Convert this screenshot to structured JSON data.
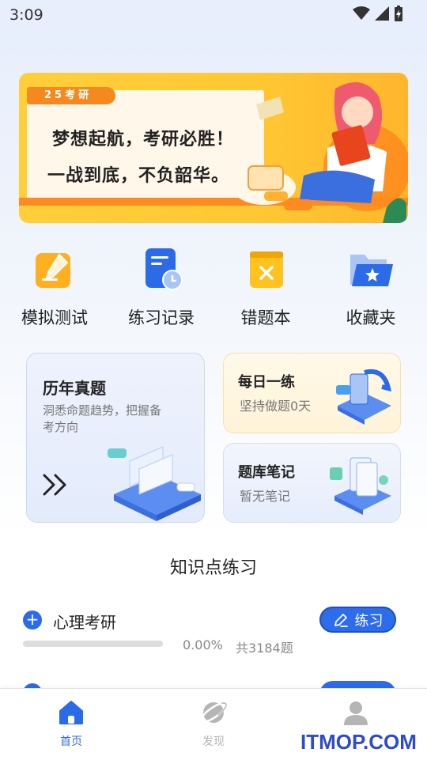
{
  "status_bar": {
    "time": "3:09"
  },
  "banner": {
    "tag": "25考研",
    "line1": "梦想起航，考研必胜！",
    "line2": "一战到底，不负韶华。"
  },
  "quick_actions": [
    {
      "label": "模拟测试",
      "icon": "pencil-note-icon"
    },
    {
      "label": "练习记录",
      "icon": "document-clock-icon"
    },
    {
      "label": "错题本",
      "icon": "wrong-book-icon"
    },
    {
      "label": "收藏夹",
      "icon": "star-folder-icon"
    }
  ],
  "cards": {
    "past_exams": {
      "title": "历年真题",
      "subtitle": "洞悉命题趋势，把握备考方向"
    },
    "daily": {
      "title": "每日一练",
      "subtitle": "坚持做题0天"
    },
    "notes": {
      "title": "题库笔记",
      "subtitle": "暂无笔记"
    }
  },
  "knowledge": {
    "section_title": "知识点练习",
    "items": [
      {
        "name": "心理考研",
        "progress_percent": 0,
        "percent_text": "0.00%",
        "total_text": "共3184题",
        "button": "练习"
      }
    ]
  },
  "bottom_nav": [
    {
      "label": "首页",
      "icon": "home-icon",
      "active": true
    },
    {
      "label": "发现",
      "icon": "planet-icon",
      "active": false
    },
    {
      "label": "",
      "icon": "user-icon",
      "active": false
    }
  ],
  "watermark": "ITMOP.COM",
  "colors": {
    "accent": "#2c6be8",
    "banner": "#ffc833",
    "inactive": "#b5b5b5"
  }
}
